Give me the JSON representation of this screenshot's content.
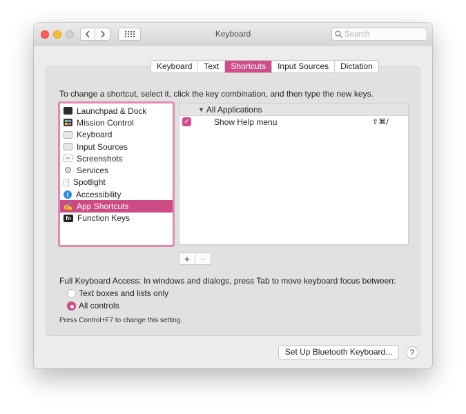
{
  "window": {
    "title": "Keyboard"
  },
  "search": {
    "placeholder": "Search"
  },
  "icons": {
    "back": "chevron-left-icon",
    "forward": "chevron-right-icon",
    "grid": "grid-icon",
    "search": "search-icon",
    "help": "help-icon"
  },
  "colors": {
    "accent": "#d04d8a",
    "selection": "#cc4b85",
    "focus_ring": "#e38ab4"
  },
  "tabs": [
    {
      "label": "Keyboard",
      "active": false
    },
    {
      "label": "Text",
      "active": false
    },
    {
      "label": "Shortcuts",
      "active": true
    },
    {
      "label": "Input Sources",
      "active": false
    },
    {
      "label": "Dictation",
      "active": false
    }
  ],
  "instruction": "To change a shortcut, select it, click the key combination, and then type the new keys.",
  "categories": [
    {
      "label": "Launchpad & Dock",
      "icon": "launchpad-dock-icon",
      "selected": false
    },
    {
      "label": "Mission Control",
      "icon": "mission-control-icon",
      "selected": false
    },
    {
      "label": "Keyboard",
      "icon": "keyboard-icon",
      "selected": false
    },
    {
      "label": "Input Sources",
      "icon": "input-sources-icon",
      "selected": false
    },
    {
      "label": "Screenshots",
      "icon": "screenshot-icon",
      "selected": false
    },
    {
      "label": "Services",
      "icon": "gear-icon",
      "selected": false
    },
    {
      "label": "Spotlight",
      "icon": "spotlight-icon",
      "selected": false
    },
    {
      "label": "Accessibility",
      "icon": "accessibility-icon",
      "selected": false
    },
    {
      "label": "App Shortcuts",
      "icon": "app-shortcuts-icon",
      "selected": true
    },
    {
      "label": "Function Keys",
      "icon": "function-keys-icon",
      "selected": false
    }
  ],
  "shortcuts": {
    "group_label": "All Applications",
    "rows": [
      {
        "enabled": true,
        "label": "Show Help menu",
        "keys": "⇧⌘/"
      }
    ]
  },
  "buttons": {
    "add": "+",
    "remove": "−",
    "bluetooth": "Set Up Bluetooth Keyboard...",
    "help": "?"
  },
  "full_keyboard_access": {
    "label": "Full Keyboard Access: In windows and dialogs, press Tab to move keyboard focus between:",
    "options": [
      {
        "label": "Text boxes and lists only",
        "selected": false
      },
      {
        "label": "All controls",
        "selected": true
      }
    ],
    "note": "Press Control+F7 to change this setting."
  }
}
